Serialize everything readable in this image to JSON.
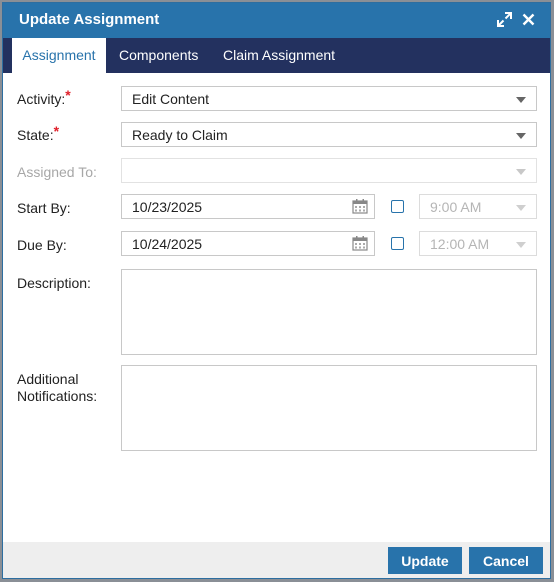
{
  "dialog": {
    "title": "Update Assignment"
  },
  "tabs": [
    {
      "label": "Assignment",
      "active": true
    },
    {
      "label": "Components",
      "active": false
    },
    {
      "label": "Claim Assignment",
      "active": false
    }
  ],
  "form": {
    "activity": {
      "label": "Activity:",
      "required": "*",
      "value": "Edit Content"
    },
    "state": {
      "label": "State:",
      "required": "*",
      "value": "Ready to Claim"
    },
    "assigned_to": {
      "label": "Assigned To:",
      "value": ""
    },
    "start_by": {
      "label": "Start By:",
      "date": "10/23/2025",
      "time": "9:00 AM"
    },
    "due_by": {
      "label": "Due By:",
      "date": "10/24/2025",
      "time": "12:00 AM"
    },
    "description": {
      "label": "Description:",
      "value": ""
    },
    "additional_notifications": {
      "label_line1": "Additional",
      "label_line2": "Notifications:",
      "value": ""
    }
  },
  "buttons": {
    "update": "Update",
    "cancel": "Cancel"
  },
  "icons": [
    "expand-icon",
    "close-icon",
    "calendar-icon",
    "chevron-down-icon"
  ],
  "colors": {
    "titlebar": "#2873ab",
    "tabbar": "#23315f",
    "required": "#e0202a",
    "button": "#2873ab"
  }
}
